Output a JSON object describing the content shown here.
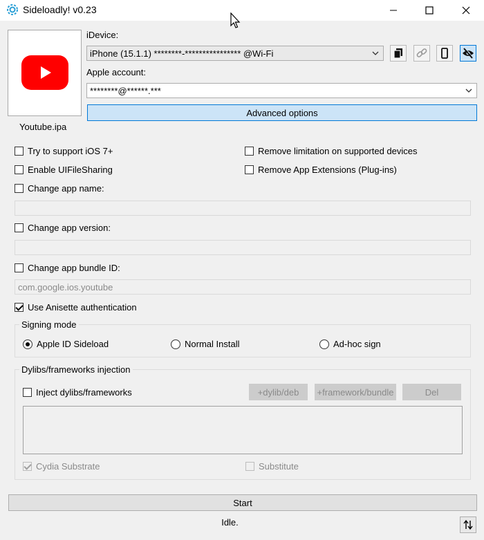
{
  "window": {
    "title": "Sideloadly! v0.23",
    "icons": {
      "app": "sideloadly-gear-icon",
      "minimize": "minimize-icon",
      "maximize": "maximize-icon",
      "close": "close-icon"
    }
  },
  "app": {
    "ipa_name": "Youtube.ipa",
    "image": "youtube-logo-icon"
  },
  "device": {
    "label": "iDevice:",
    "selected": "iPhone (15.1.1) ********-**************** @Wi-Fi",
    "buttons": [
      "copy-icon",
      "link-icon",
      "phone-icon",
      "eye-slash-icon"
    ]
  },
  "account": {
    "label": "Apple account:",
    "selected": "********@******.***"
  },
  "advanced_label": "Advanced options",
  "options": {
    "ios7": "Try to support iOS 7+",
    "remove_limitation": "Remove limitation on supported devices",
    "file_sharing": "Enable UIFileSharing",
    "remove_extensions": "Remove App Extensions (Plug-ins)",
    "change_name": "Change app name:",
    "change_name_value": "",
    "change_version": "Change app version:",
    "change_version_value": "",
    "change_bundle": "Change app bundle ID:",
    "bundle_placeholder": "com.google.ios.youtube",
    "anisette": "Use Anisette authentication",
    "anisette_checked": true
  },
  "signing": {
    "title": "Signing mode",
    "modes": [
      "Apple ID Sideload",
      "Normal Install",
      "Ad-hoc sign"
    ],
    "selected": "Apple ID Sideload"
  },
  "dylibs": {
    "title": "Dylibs/frameworks injection",
    "inject_label": "Inject dylibs/frameworks",
    "add_dylib": "+dylib/deb",
    "add_framework": "+framework/bundle",
    "delete": "Del",
    "cydia": "Cydia Substrate",
    "cydia_checked": true,
    "substitute": "Substitute"
  },
  "start_label": "Start",
  "status": "Idle.",
  "sort_icon": "up-down-arrows-icon"
}
